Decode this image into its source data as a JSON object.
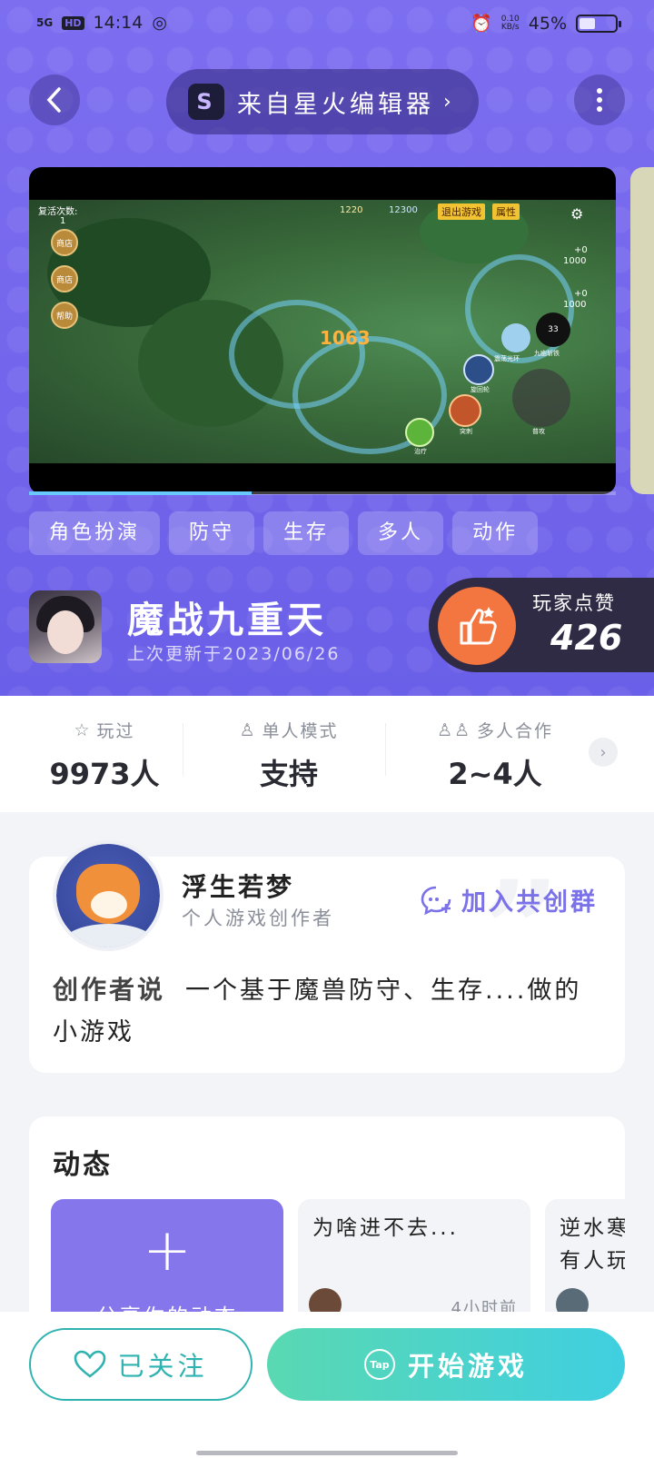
{
  "status_bar": {
    "network": "5G",
    "hd": "HD",
    "time": "14:14",
    "speed_value": "0.10",
    "speed_unit": "KB/s",
    "battery": "45%",
    "battery_level": 0.45
  },
  "header": {
    "editor_label": "来自星火编辑器",
    "editor_arrow": "›",
    "logo_letter": "S"
  },
  "video": {
    "revive_label": "复活次数:",
    "revive_count": "1",
    "btn_store": "商店",
    "btn_shop": "商店",
    "btn_help": "帮助",
    "coins_a": "1220",
    "coins_b": "12300",
    "exit_btn": "退出游戏",
    "attr_btn": "属性",
    "plus_a": "+0",
    "val_a": "1000",
    "plus_b": "+0",
    "val_b": "1000",
    "damage": "1063",
    "skill_count": "33",
    "skill_label": "九幽斩铁",
    "skill_a": "震荡光环",
    "skill_b": "旋回轮",
    "skill_c": "突刺",
    "skill_d": "治疗",
    "skill_e": "普攻",
    "progress": 0.38
  },
  "tags": [
    "角色扮演",
    "防守",
    "生存",
    "多人",
    "动作"
  ],
  "game": {
    "name": "魔战九重天",
    "updated": "上次更新于2023/06/26"
  },
  "likes": {
    "label": "玩家点赞",
    "count": "426"
  },
  "stats": [
    {
      "label": "玩过",
      "value": "9973人",
      "icon": "star-icon"
    },
    {
      "label": "单人模式",
      "value": "支持",
      "icon": "person-icon"
    },
    {
      "label": "多人合作",
      "value": "2~4人",
      "icon": "group-icon"
    }
  ],
  "stats_more": "›",
  "creator": {
    "name": "浮生若梦",
    "role": "个人游戏创作者",
    "join_label": "加入共创群",
    "says_label": "创作者说",
    "says_text": "一个基于魔兽防守、生存....做的小游戏"
  },
  "feed": {
    "title": "动态",
    "share_plus": "+",
    "share_label": "分享你的动态",
    "posts": [
      {
        "title": "为啥进不去...",
        "time": "4小时前"
      },
      {
        "title": "逆水寒有人玩",
        "time": ""
      }
    ]
  },
  "actions": {
    "follow": "已关注",
    "play": "开始游戏",
    "tap_logo": "Tap"
  },
  "colors": {
    "accent": "#7d6ef0",
    "like_orange": "#f3753f",
    "teal": "#2fb3b0"
  }
}
